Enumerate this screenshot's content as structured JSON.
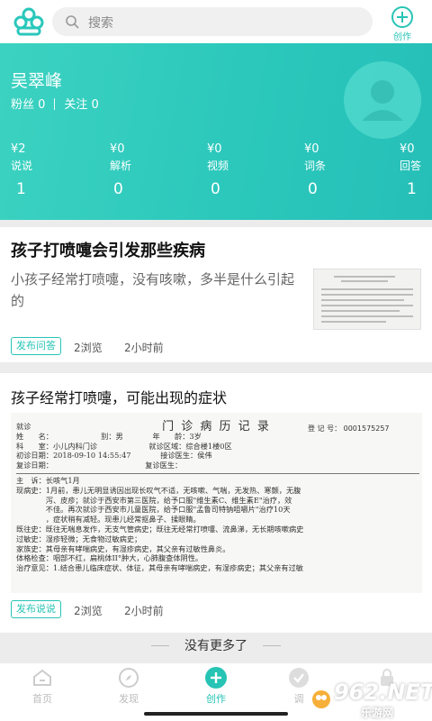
{
  "search": {
    "placeholder": "搜索"
  },
  "header": {
    "create_label": "创作"
  },
  "profile": {
    "name": "吴翠峰",
    "followers_label": "粉丝 0",
    "following_label": "关注 0",
    "stats": [
      {
        "money": "¥2",
        "label": "说说",
        "count": "1"
      },
      {
        "money": "¥0",
        "label": "解析",
        "count": "0"
      },
      {
        "money": "¥0",
        "label": "视频",
        "count": "0"
      },
      {
        "money": "¥0",
        "label": "词条",
        "count": "0"
      },
      {
        "money": "¥0",
        "label": "回答",
        "count": "1"
      }
    ]
  },
  "posts": [
    {
      "title": "孩子打喷嚏会引发那些疾病",
      "desc": "小孩子经常打喷嚏，没有咳嗽，多半是什么引起的",
      "tag": "发布问答",
      "views": "2浏览",
      "time": "2小时前"
    },
    {
      "title": "孩子经常打喷嚏，可能出现的症状",
      "tag": "发布说说",
      "views": "2浏览",
      "time": "2小时前"
    }
  ],
  "record": {
    "heading": "门 诊 病 历 记 录",
    "reg_no": "登 记 号： 0001575257",
    "rows": [
      "就诊",
      "姓　　名：　　　　　　　别：男　　　　年　　龄：3岁",
      "科　　室：小儿内科门诊　　　　　　　就诊区域：综合楼1楼0区",
      "初诊日期：2018-09-10 14:55:47　　　　接诊医生：侯伟",
      "复诊日期：　　　　　　　　　　　　　复诊医生：",
      "主　诉：长咳气1月",
      "现病史：1月前，患儿无明显诱因出现长叹气不适，无咳嗽、气喘，无发热、寒颤，无腹",
      "　　　　泻、皮疹；就诊于西安市第三医院，给予口服\"维生素C、维生素E\"治疗，效",
      "　　　　不佳。再次就诊于西安市儿童医院，给予口服\"孟鲁司特钠咀嚼片\"治疗10天",
      "　　　　，症状稍有减轻。现患儿经常抠鼻子、揉眼睛。",
      "既往史：既往无喘息发作，无支气管病史；既往无经常打喷嚏、流鼻涕，无长期咳嗽病史",
      "过敏史：湿疹轻微；无食物过敏病史；",
      "家族史：其母亲有哮喘病史，有湿疹病史，其父亲有过敏性鼻炎。",
      "体格检查：咽部不红，扁桃体II°肿大，心肺腹查体阴性。",
      "治疗意见：1.结合患儿临床症状、体征，其母亲有哮喘病史，有湿疹病史；其父亲有过敏"
    ]
  },
  "list_end": "没有更多了",
  "tabs": [
    {
      "label": "首页",
      "icon": "home-icon"
    },
    {
      "label": "发现",
      "icon": "compass-icon"
    },
    {
      "label": "创作",
      "icon": "plus-icon"
    },
    {
      "label": "调",
      "icon": "check-icon"
    },
    {
      "label": "",
      "icon": "lock-icon"
    }
  ],
  "watermark": {
    "text": "962.NET",
    "subtext": "乐游网"
  },
  "colors": {
    "accent": "#27c4b5"
  }
}
